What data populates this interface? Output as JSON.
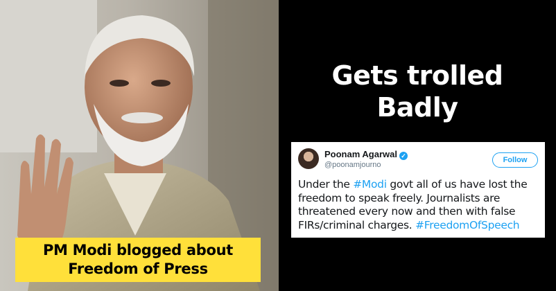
{
  "caption": {
    "line1": "PM Modi blogged about",
    "line2": "Freedom of Press"
  },
  "headline": {
    "line1": "Gets trolled",
    "line2": "Badly"
  },
  "tweet": {
    "name": "Poonam Agarwal",
    "verified_icon": "✓",
    "handle": "@poonamjourno",
    "follow_label": "Follow",
    "lines": [
      {
        "before": "Under the ",
        "hashtag": "#Modi",
        "after": " govt all of us have lost the"
      },
      {
        "before": "freedom to speak freely. Journalists are",
        "hashtag": "",
        "after": ""
      },
      {
        "before": "threatened every now and then with false",
        "hashtag": "",
        "after": ""
      },
      {
        "before": "FIRs/criminal charges. ",
        "hashtag": "#FreedomOfSpeech",
        "after": ""
      }
    ]
  },
  "colors": {
    "caption_bg": "#ffe03a",
    "twitter_blue": "#1da1f2",
    "background": "#000000"
  }
}
